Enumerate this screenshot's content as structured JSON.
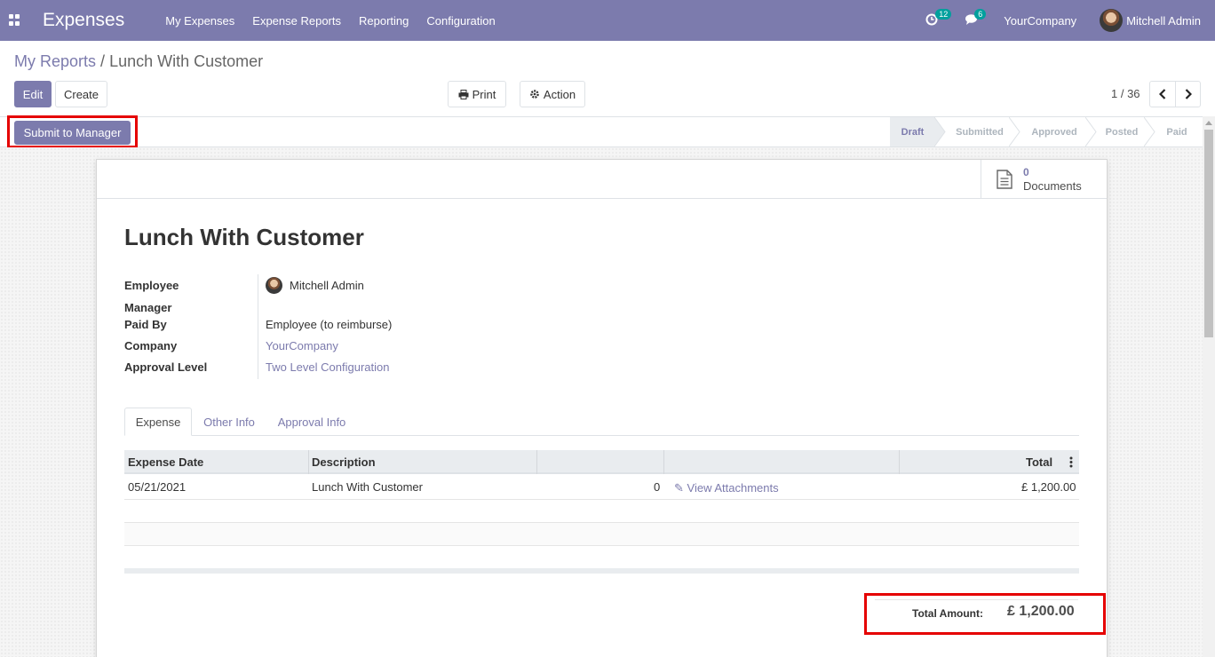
{
  "navbar": {
    "app_title": "Expenses",
    "menu": [
      "My Expenses",
      "Expense Reports",
      "Reporting",
      "Configuration"
    ],
    "activity_badge": "12",
    "message_badge": "6",
    "company": "YourCompany",
    "user": "Mitchell Admin"
  },
  "breadcrumb": {
    "parent": "My Reports",
    "separator": "/",
    "current": "Lunch With Customer"
  },
  "toolbar": {
    "edit_label": "Edit",
    "create_label": "Create",
    "print_label": "Print",
    "action_label": "Action",
    "pager": "1 / 36"
  },
  "statusbar": {
    "submit_label": "Submit to Manager",
    "stages": [
      "Draft",
      "Submitted",
      "Approved",
      "Posted",
      "Paid"
    ],
    "active_stage": "Draft"
  },
  "smart_button": {
    "count": "0",
    "label": "Documents"
  },
  "form": {
    "title": "Lunch With Customer",
    "fields": {
      "employee_label": "Employee",
      "employee_value": "Mitchell Admin",
      "manager_label": "Manager",
      "paid_by_label": "Paid By",
      "paid_by_value": "Employee (to reimburse)",
      "company_label": "Company",
      "company_value": "YourCompany",
      "approval_label": "Approval Level",
      "approval_value": "Two Level Configuration"
    },
    "tabs": [
      "Expense",
      "Other Info",
      "Approval Info"
    ],
    "table": {
      "headers": [
        "Expense Date",
        "Description",
        "",
        "",
        "Total"
      ],
      "rows": [
        {
          "date": "05/21/2021",
          "description": "Lunch With Customer",
          "qty": "0",
          "attachments": "View Attachments",
          "total": "£ 1,200.00"
        }
      ]
    },
    "total_label": "Total Amount:",
    "total_value": "£ 1,200.00"
  },
  "colors": {
    "brand": "#7c7bad",
    "highlight": "#e50000",
    "badge": "#00a09d"
  }
}
